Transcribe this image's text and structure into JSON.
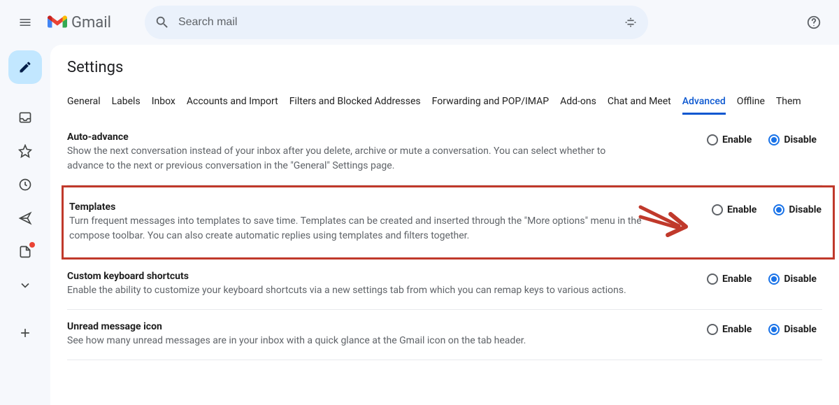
{
  "header": {
    "product_name": "Gmail",
    "search_placeholder": "Search mail"
  },
  "page": {
    "title": "Settings"
  },
  "tabs": [
    "General",
    "Labels",
    "Inbox",
    "Accounts and Import",
    "Filters and Blocked Addresses",
    "Forwarding and POP/IMAP",
    "Add-ons",
    "Chat and Meet",
    "Advanced",
    "Offline",
    "Them"
  ],
  "active_tab": "Advanced",
  "labels": {
    "enable": "Enable",
    "disable": "Disable"
  },
  "settings": [
    {
      "id": "auto_advance",
      "title": "Auto-advance",
      "desc": "Show the next conversation instead of your inbox after you delete, archive or mute a conversation. You can select whether to advance to the next or previous conversation in the \"General\" Settings page.",
      "selected": "disable",
      "highlighted": false
    },
    {
      "id": "templates",
      "title": "Templates",
      "desc": "Turn frequent messages into templates to save time. Templates can be created and inserted through the \"More options\" menu in the compose toolbar. You can also create automatic replies using templates and filters together.",
      "selected": "disable",
      "highlighted": true
    },
    {
      "id": "custom_keyboard_shortcuts",
      "title": "Custom keyboard shortcuts",
      "desc": "Enable the ability to customize your keyboard shortcuts via a new settings tab from which you can remap keys to various actions.",
      "selected": "disable",
      "highlighted": false
    },
    {
      "id": "unread_message_icon",
      "title": "Unread message icon",
      "desc": "See how many unread messages are in your inbox with a quick glance at the Gmail icon on the tab header.",
      "selected": "disable",
      "highlighted": false
    }
  ]
}
